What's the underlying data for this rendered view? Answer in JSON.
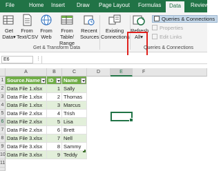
{
  "ribbon_tabs": {
    "file": "File",
    "home": "Home",
    "insert": "Insert",
    "draw": "Draw",
    "page_layout": "Page Layout",
    "formulas": "Formulas",
    "data": "Data",
    "review": "Review"
  },
  "get_transform": {
    "get_data": "Get",
    "get_data_2": "Data",
    "from_text": "From",
    "from_text_2": "Text/CSV",
    "from_web": "From",
    "from_web_2": "Web",
    "from_table": "From Table/",
    "from_table_2": "Range",
    "recent_sources": "Recent",
    "recent_sources_2": "Sources",
    "existing_connections": "Existing",
    "existing_connections_2": "Connections",
    "group_label": "Get & Transform Data"
  },
  "queries_connections": {
    "refresh_all": "Refresh",
    "refresh_all_2": "All",
    "queries_connections": "Queries & Connections",
    "properties": "Properties",
    "edit_links": "Edit Links",
    "group_label": "Queries & Connections"
  },
  "formula_bar": {
    "name_box": "E6",
    "formula": ""
  },
  "columns": [
    "A",
    "B",
    "C",
    "D",
    "E",
    "F"
  ],
  "rows": [
    "1",
    "2",
    "3",
    "4",
    "5",
    "6",
    "7",
    "8",
    "9",
    "10",
    "11",
    "12"
  ],
  "table": {
    "headers": [
      "Source.Name",
      "ID",
      "Name"
    ],
    "rows": [
      [
        "Data File 1.xlsx",
        "1",
        "Sally"
      ],
      [
        "Data File 1.xlsx",
        "2",
        "Thomas"
      ],
      [
        "Data File 1.xlsx",
        "3",
        "Marcus"
      ],
      [
        "Data File 2.xlsx",
        "4",
        "Trish"
      ],
      [
        "Data File 2.xlsx",
        "5",
        "Lisa"
      ],
      [
        "Data File 2.xlsx",
        "6",
        "Brett"
      ],
      [
        "Data File 3.xlsx",
        "7",
        "Nell"
      ],
      [
        "Data File 3.xlsx",
        "8",
        "Sammy"
      ],
      [
        "Data File 3.xlsx",
        "9",
        "Teddy"
      ]
    ]
  },
  "colors": {
    "accent": "#217346",
    "table_header": "#70ad47",
    "table_band": "#e2efda",
    "highlight_box": "#e0201c"
  }
}
